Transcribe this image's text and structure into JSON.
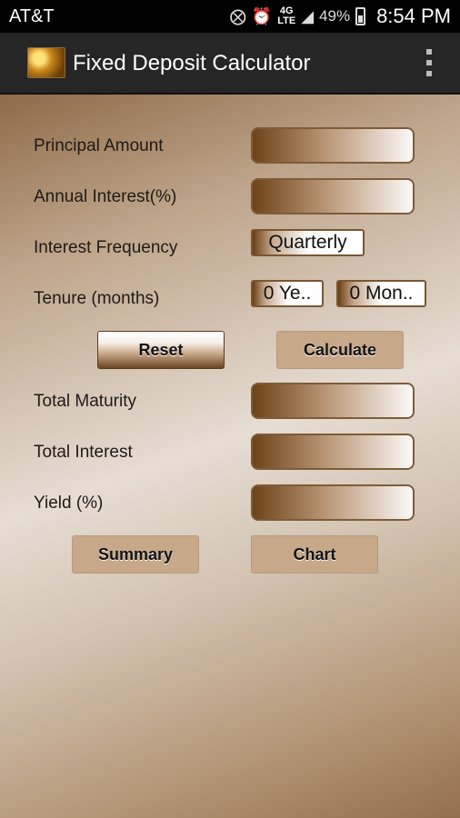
{
  "status": {
    "carrier": "AT&T",
    "network": "4G",
    "network_sub": "LTE",
    "battery": "49%",
    "time": "8:54 PM"
  },
  "app": {
    "title": "Fixed Deposit Calculator"
  },
  "form": {
    "principal_label": "Principal Amount",
    "interest_label": "Annual Interest(%)",
    "frequency_label": "Interest Frequency",
    "frequency_value": "Quarterly",
    "tenure_label": "Tenure (months)",
    "tenure_years": "0 Ye..",
    "tenure_months": "0 Mon..",
    "reset_label": "Reset",
    "calculate_label": "Calculate",
    "maturity_label": "Total Maturity",
    "total_interest_label": "Total Interest",
    "yield_label": "Yield (%)",
    "summary_label": "Summary",
    "chart_label": "Chart"
  }
}
